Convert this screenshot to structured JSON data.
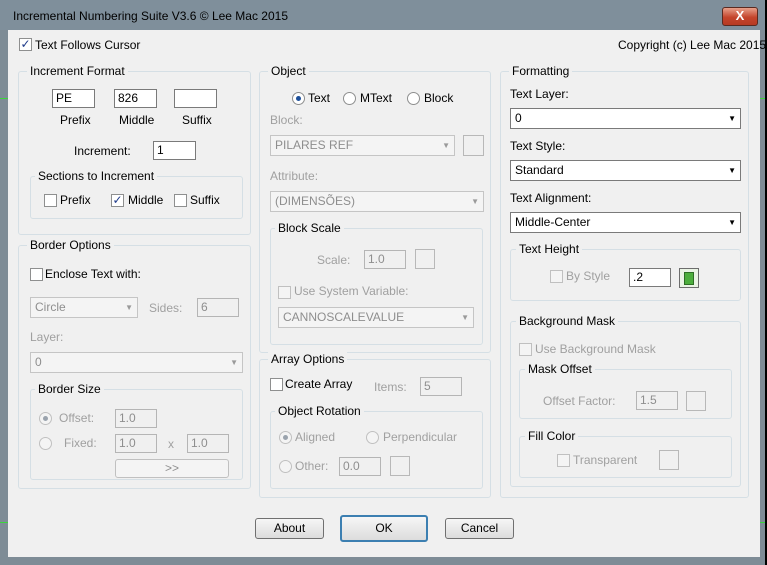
{
  "window": {
    "title": "Incremental Numbering Suite V3.6 © Lee Mac 2015",
    "close_label": "X"
  },
  "top": {
    "follow_cursor_label": "Text Follows Cursor",
    "follow_cursor_checked": true,
    "copyright": "Copyright (c) Lee Mac 2015"
  },
  "increment_format": {
    "title": "Increment Format",
    "prefix_value": "PE",
    "middle_value": "826",
    "suffix_value": "",
    "prefix_label": "Prefix",
    "middle_label": "Middle",
    "suffix_label": "Suffix",
    "increment_label": "Increment:",
    "increment_value": "1",
    "sections_title": "Sections to Increment",
    "sec_prefix": "Prefix",
    "sec_middle": "Middle",
    "sec_suffix": "Suffix"
  },
  "border_options": {
    "title": "Border Options",
    "enclose_label": "Enclose Text with:",
    "shape_value": "Circle",
    "sides_label": "Sides:",
    "sides_value": "6",
    "layer_label": "Layer:",
    "layer_value": "0",
    "size_title": "Border Size",
    "offset_label": "Offset:",
    "offset_value": "1.0",
    "fixed_label": "Fixed:",
    "fixed_w": "1.0",
    "x_label": "x",
    "fixed_h": "1.0",
    "pick_label": ">>"
  },
  "object": {
    "title": "Object",
    "text_label": "Text",
    "mtext_label": "MText",
    "block_label": "Block",
    "block_field_label": "Block:",
    "block_value": "PILARES REF",
    "attribute_label": "Attribute:",
    "attribute_value": "(DIMENSÕES)",
    "scale_title": "Block Scale",
    "scale_label": "Scale:",
    "scale_value": "1.0",
    "sysvar_label": "Use System Variable:",
    "sysvar_value": "CANNOSCALEVALUE"
  },
  "array": {
    "title": "Array Options",
    "create_label": "Create Array",
    "items_label": "Items:",
    "items_value": "5",
    "rotation_title": "Object Rotation",
    "aligned_label": "Aligned",
    "perpendicular_label": "Perpendicular",
    "other_label": "Other:",
    "other_value": "0.0"
  },
  "formatting": {
    "title": "Formatting",
    "layer_label": "Text Layer:",
    "layer_value": "0",
    "style_label": "Text Style:",
    "style_value": "Standard",
    "align_label": "Text Alignment:",
    "align_value": "Middle-Center",
    "height_title": "Text Height",
    "by_style_label": "By Style",
    "height_value": ".2",
    "mask_title": "Background Mask",
    "use_mask_label": "Use Background Mask",
    "mask_offset_title": "Mask Offset",
    "offset_factor_label": "Offset Factor:",
    "offset_factor_value": "1.5",
    "fill_title": "Fill Color",
    "transparent_label": "Transparent"
  },
  "footer": {
    "about_label": "About",
    "ok_label": "OK",
    "cancel_label": "Cancel"
  },
  "colors": {
    "accent": "#3c7fb1",
    "close": "#c4452c",
    "title_bar": "#7f8f9b"
  }
}
